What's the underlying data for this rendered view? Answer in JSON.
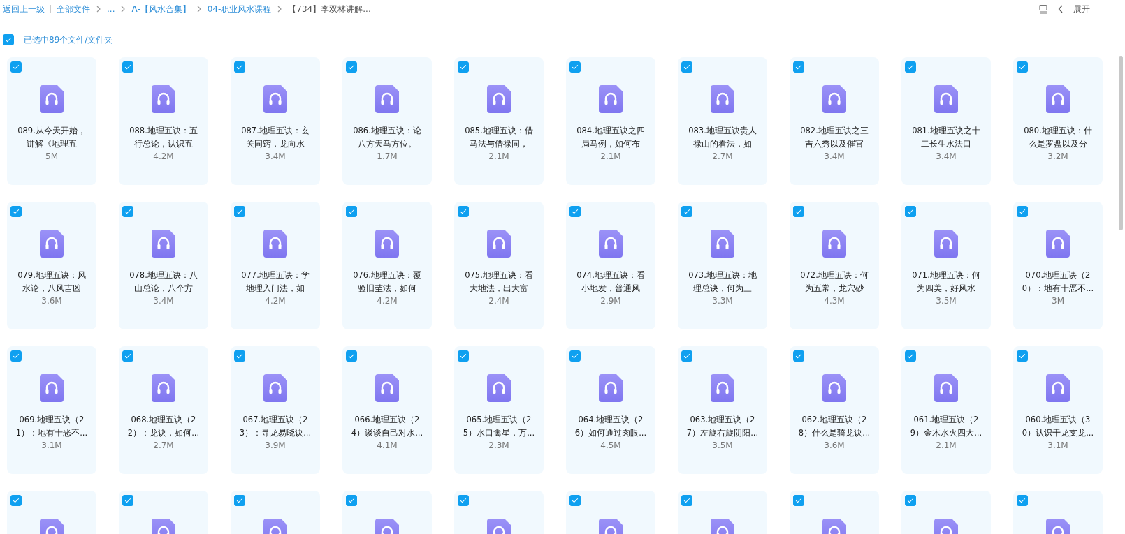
{
  "breadcrumb": {
    "back": "返回上一级",
    "items": [
      {
        "label": "全部文件",
        "current": false
      },
      {
        "label": "...",
        "current": false
      },
      {
        "label": "A-【风水合集】",
        "current": false
      },
      {
        "label": "04-职业风水课程",
        "current": false
      },
      {
        "label": "【734】李双林讲解...",
        "current": true
      }
    ],
    "expand": "展开"
  },
  "selection": {
    "checked": true,
    "label": "已选中89个文件/文件夹"
  },
  "files": [
    {
      "lines": [
        "089.从今天开始，",
        "讲解《地理五"
      ],
      "size": "5M",
      "checked": true
    },
    {
      "lines": [
        "088.地理五诀：五",
        "行总论，认识五"
      ],
      "size": "4.2M",
      "checked": true
    },
    {
      "lines": [
        "087.地理五诀：玄",
        "关同窍，龙向水"
      ],
      "size": "3.4M",
      "checked": true
    },
    {
      "lines": [
        "086.地理五诀：论",
        "八方天马方位。"
      ],
      "size": "1.7M",
      "checked": true
    },
    {
      "lines": [
        "085.地理五诀：借",
        "马法与借禄同，"
      ],
      "size": "2.1M",
      "checked": true
    },
    {
      "lines": [
        "084.地理五诀之四",
        "局马例，如何布"
      ],
      "size": "2.1M",
      "checked": true
    },
    {
      "lines": [
        "083.地理五诀贵人",
        "禄山的看法，如"
      ],
      "size": "2.7M",
      "checked": true
    },
    {
      "lines": [
        "082.地理五诀之三",
        "吉六秀以及催官"
      ],
      "size": "3.4M",
      "checked": true
    },
    {
      "lines": [
        "081.地理五诀之十",
        "二长生水法口"
      ],
      "size": "3.4M",
      "checked": true
    },
    {
      "lines": [
        "080.地理五诀：什",
        "么是罗盘以及分"
      ],
      "size": "3.2M",
      "checked": true
    },
    {
      "lines": [
        "079.地理五诀：风",
        "水论，八风吉凶"
      ],
      "size": "3.6M",
      "checked": true
    },
    {
      "lines": [
        "078.地理五诀：八",
        "山总论，八个方"
      ],
      "size": "3.4M",
      "checked": true
    },
    {
      "lines": [
        "077.地理五诀：学",
        "地理入门法，如"
      ],
      "size": "4.2M",
      "checked": true
    },
    {
      "lines": [
        "076.地理五诀：覆",
        "验旧茔法，如何"
      ],
      "size": "4.2M",
      "checked": true
    },
    {
      "lines": [
        "075.地理五诀：看",
        "大地法，出大富"
      ],
      "size": "2.4M",
      "checked": true
    },
    {
      "lines": [
        "074.地理五诀：看",
        "小地发，普通风"
      ],
      "size": "2.9M",
      "checked": true
    },
    {
      "lines": [
        "073.地理五诀：地",
        "理总诀，何为三"
      ],
      "size": "3.3M",
      "checked": true
    },
    {
      "lines": [
        "072.地理五诀：何",
        "为五常，龙穴砂"
      ],
      "size": "4.3M",
      "checked": true
    },
    {
      "lines": [
        "071.地理五诀：何",
        "为四美，好风水"
      ],
      "size": "3.5M",
      "checked": true
    },
    {
      "lines": [
        "070.地理五诀（2",
        "0）：地有十恶不..."
      ],
      "size": "3M",
      "checked": true
    },
    {
      "lines": [
        "069.地理五诀（2",
        "1）：地有十恶不..."
      ],
      "size": "3.1M",
      "checked": true
    },
    {
      "lines": [
        "068.地理五诀（2",
        "2）：龙诀，如何..."
      ],
      "size": "2.7M",
      "checked": true
    },
    {
      "lines": [
        "067.地理五诀（2",
        "3）：寻龙易晓诀..."
      ],
      "size": "3.9M",
      "checked": true
    },
    {
      "lines": [
        "066.地理五诀（2",
        "4）谈谈自己对水..."
      ],
      "size": "4.1M",
      "checked": true
    },
    {
      "lines": [
        "065.地理五诀（2",
        "5）水口禽星，万..."
      ],
      "size": "2.3M",
      "checked": true
    },
    {
      "lines": [
        "064.地理五诀（2",
        "6）如何通过肉眼..."
      ],
      "size": "4.5M",
      "checked": true
    },
    {
      "lines": [
        "063.地理五诀（2",
        "7）左旋右旋阴阳..."
      ],
      "size": "3.5M",
      "checked": true
    },
    {
      "lines": [
        "062.地理五诀（2",
        "8）什么是骑龙诀..."
      ],
      "size": "3.6M",
      "checked": true
    },
    {
      "lines": [
        "061.地理五诀（2",
        "9）金木水火四大..."
      ],
      "size": "2.1M",
      "checked": true
    },
    {
      "lines": [
        "060.地理五诀（3",
        "0）认识干龙支龙..."
      ],
      "size": "3.1M",
      "checked": true
    },
    {
      "checked": true
    },
    {
      "checked": true
    },
    {
      "checked": true
    },
    {
      "checked": true
    },
    {
      "checked": true
    },
    {
      "checked": true
    },
    {
      "checked": true
    },
    {
      "checked": true
    },
    {
      "checked": true
    },
    {
      "checked": true
    }
  ]
}
